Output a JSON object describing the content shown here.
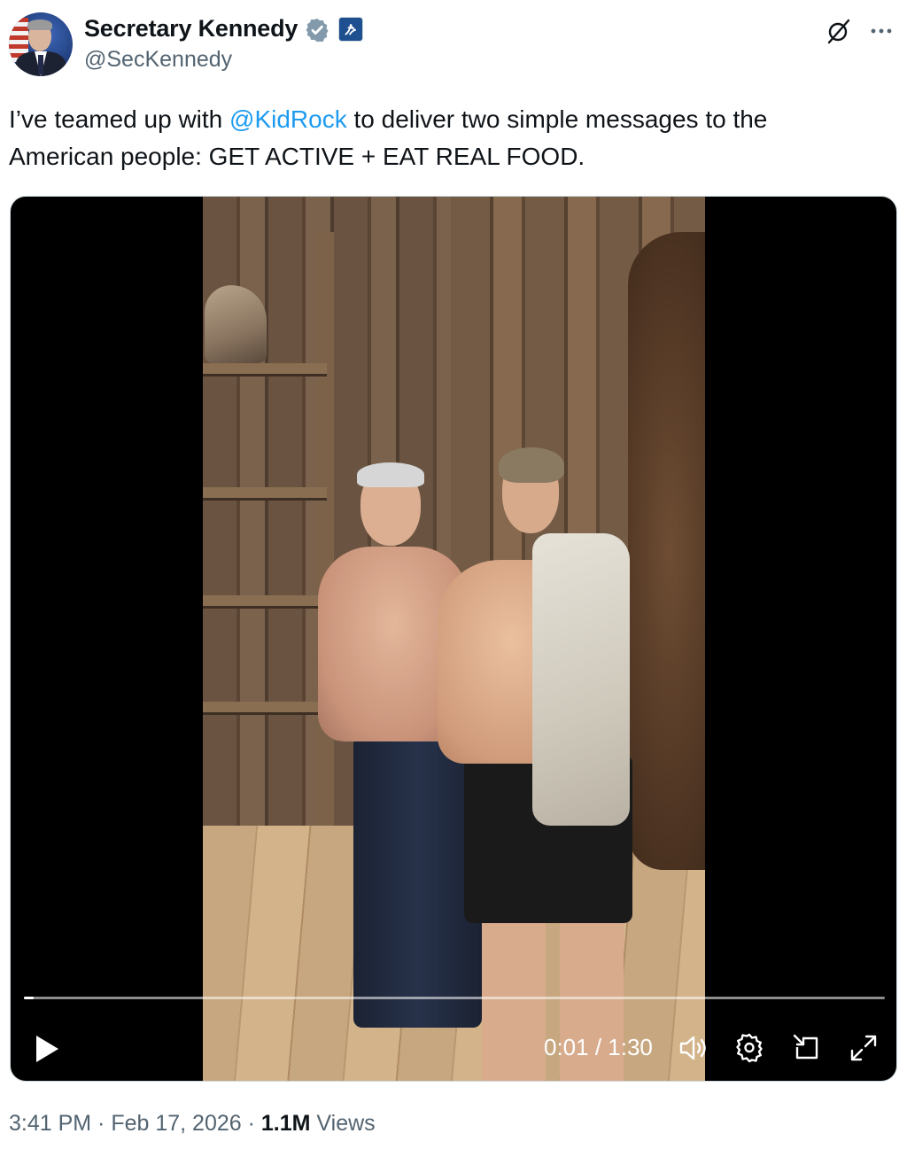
{
  "author": {
    "name": "Secretary Kennedy",
    "handle": "@SecKennedy",
    "badge_color": "#829aab"
  },
  "tweet": {
    "text_before": "I’ve teamed up with ",
    "mention": "@KidRock",
    "text_after": " to deliver two simple messages to the American people: GET ACTIVE + EAT REAL FOOD.",
    "mention_color": "#1d9bf0"
  },
  "video": {
    "time_display": "0:01 / 1:30",
    "progress": 0.011
  },
  "meta": {
    "time": "3:41 PM",
    "sep1": " · ",
    "date": "Feb 17, 2026",
    "sep2": " · ",
    "views_count": "1.1M",
    "views_label": " Views"
  },
  "icons": {
    "verified": "verified-badge-icon",
    "affiliation": "hhs-logo-icon",
    "grok": "grok-icon",
    "more": "more-icon",
    "play": "play-icon",
    "volume": "volume-icon",
    "settings": "settings-icon",
    "pip": "picture-in-picture-icon",
    "fullscreen": "fullscreen-icon"
  }
}
